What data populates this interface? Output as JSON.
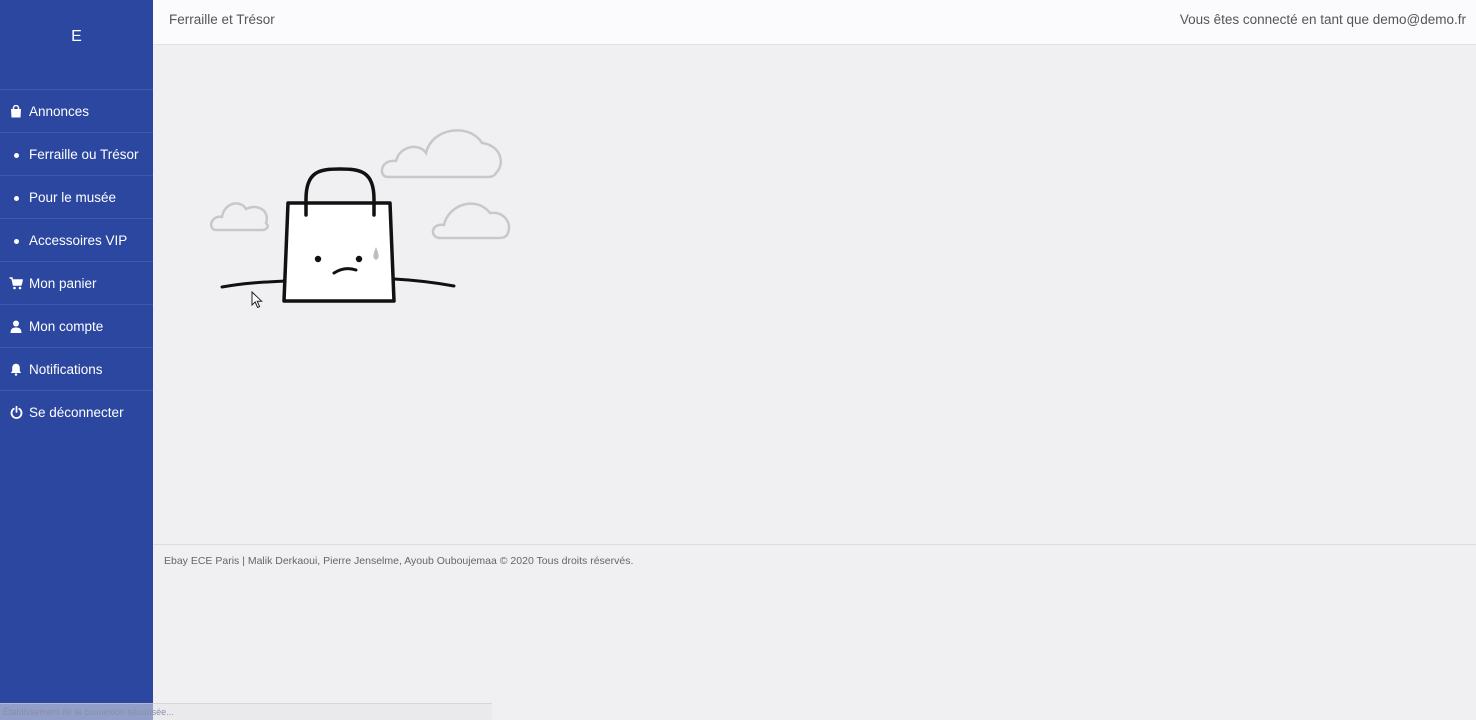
{
  "sidebar": {
    "brand": "E",
    "items": [
      {
        "label": "Annonces",
        "icon": "shopping-bag-icon"
      },
      {
        "label": "Ferraille ou Trésor",
        "icon": "bullet-icon"
      },
      {
        "label": "Pour le musée",
        "icon": "bullet-icon"
      },
      {
        "label": "Accessoires VIP",
        "icon": "bullet-icon"
      },
      {
        "label": "Mon panier",
        "icon": "cart-icon"
      },
      {
        "label": "Mon compte",
        "icon": "user-icon"
      },
      {
        "label": "Notifications",
        "icon": "bell-icon"
      },
      {
        "label": "Se déconnecter",
        "icon": "power-icon"
      }
    ]
  },
  "header": {
    "title": "Ferraille et Trésor",
    "user_text": "Vous êtes connecté en tant que demo@demo.fr"
  },
  "main": {
    "illustration": "empty-shopping-bag-illustration"
  },
  "footer": {
    "text": "Ebay ECE Paris | Malik Derkaoui, Pierre Jenselme, Ayoub Ouboujemaa © 2020 Tous droits réservés."
  },
  "statusbar": {
    "text": "Établissement de la connexion sécurisée..."
  },
  "colors": {
    "sidebar_bg": "#2b47a0",
    "page_bg": "#f0eff2",
    "header_bg": "#fbfbfd"
  }
}
